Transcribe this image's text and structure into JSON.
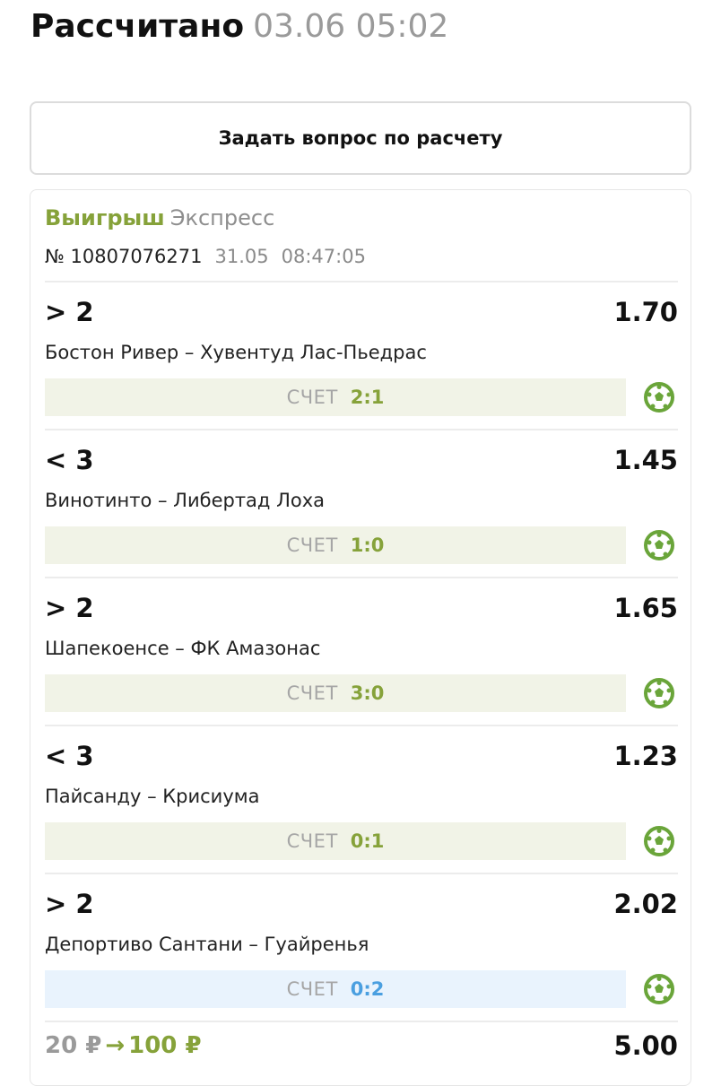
{
  "header": {
    "title": "Рассчитано",
    "datetime": "03.06 05:02"
  },
  "ask_button_label": "Задать вопрос по расчету",
  "bet": {
    "status": "Выигрыш",
    "kind": "Экспресс",
    "number": "№ 10807076271",
    "date": "31.05",
    "time": "08:47:05"
  },
  "events": [
    {
      "outcome": "> 2",
      "odds": "1.70",
      "teams": "Бостон Ривер – Хувентуд Лас-Пьедрас",
      "score_label": "СЧЕТ",
      "score": "2:1",
      "score_state": "green"
    },
    {
      "outcome": "< 3",
      "odds": "1.45",
      "teams": "Винотинто – Либертад Лоха",
      "score_label": "СЧЕТ",
      "score": "1:0",
      "score_state": "green"
    },
    {
      "outcome": "> 2",
      "odds": "1.65",
      "teams": "Шапекоенсе – ФК Амазонас",
      "score_label": "СЧЕТ",
      "score": "3:0",
      "score_state": "green"
    },
    {
      "outcome": "< 3",
      "odds": "1.23",
      "teams": "Пайсанду – Крисиума",
      "score_label": "СЧЕТ",
      "score": "0:1",
      "score_state": "green"
    },
    {
      "outcome": "> 2",
      "odds": "2.02",
      "teams": "Депортиво Сантани – Гуайренья",
      "score_label": "СЧЕТ",
      "score": "0:2",
      "score_state": "blue"
    }
  ],
  "footer": {
    "stake": "20 ₽",
    "arrow": "→",
    "payout": "100 ₽",
    "total_odds": "5.00"
  },
  "colors": {
    "win_green": "#86a23a",
    "score_green_bg": "#f1f3e7",
    "score_blue_bg": "#e9f3fd",
    "score_blue_text": "#4a9fe0",
    "ball_green": "#6aa53a"
  },
  "icons": {
    "sport": "soccer-ball-icon",
    "arrow": "arrow-right-icon"
  }
}
